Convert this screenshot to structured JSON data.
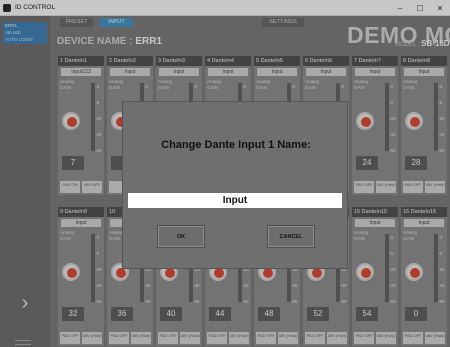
{
  "window": {
    "title": "ID CONTROL",
    "controls": [
      "–",
      "☐",
      "✕"
    ]
  },
  "sidebar": {
    "units": [
      {
        "label": "ERR1",
        "selected": true
      },
      {
        "label": "SB-16D",
        "selected": false
      },
      {
        "label": "AUTO LOGIN",
        "selected": false
      }
    ],
    "next_label": "›"
  },
  "tabs": [
    {
      "label": "PRESET"
    },
    {
      "label": "INPUT",
      "active": true
    },
    {
      "label": "SETTINGS"
    }
  ],
  "device": {
    "name_prefix": "DEVICE NAME :",
    "name_value": "ERR1",
    "demo_text": "DEMO MODE",
    "model_label": "MODEL :",
    "model_value": "SB-16D"
  },
  "channels": [
    {
      "header": "1  DanteIn1",
      "name": "Input123",
      "gain": "7",
      "pad": "PAD ON",
      "phantom": "48V OFF"
    },
    {
      "header": "2  DanteIn2",
      "name": "Input",
      "gain": "",
      "pad": "",
      "phantom": ""
    },
    {
      "header": "3  DanteIn3",
      "name": "Input",
      "gain": "",
      "pad": "",
      "phantom": ""
    },
    {
      "header": "4  DanteIn4",
      "name": "Input",
      "gain": "",
      "pad": "",
      "phantom": ""
    },
    {
      "header": "5  DanteIn5",
      "name": "Input",
      "gain": "",
      "pad": "",
      "phantom": ""
    },
    {
      "header": "6  DanteIn6",
      "name": "Input",
      "gain": "",
      "pad": "",
      "phantom": ""
    },
    {
      "header": "7  DanteIn7",
      "name": "Input",
      "gain": "24",
      "pad": "PAD OFF",
      "phantom": "48V (Hold)"
    },
    {
      "header": "8  DanteIn8",
      "name": "Input",
      "gain": "28",
      "pad": "PAD OFF",
      "phantom": "48V (Hold)"
    },
    {
      "header": "9  DanteIn9",
      "name": "Input",
      "gain": "32",
      "pad": "PAD OFF",
      "phantom": "48V (Hold)"
    },
    {
      "header": "10",
      "name": "",
      "gain": "36",
      "pad": "PAD OFF",
      "phantom": "48V (Hold)"
    },
    {
      "header": "",
      "name": "",
      "gain": "40",
      "pad": "PAD OFF",
      "phantom": "48V (Hold)"
    },
    {
      "header": "",
      "name": "",
      "gain": "44",
      "pad": "PAD OFF",
      "phantom": "48V (Hold)"
    },
    {
      "header": "",
      "name": "",
      "gain": "48",
      "pad": "PAD OFF",
      "phantom": "48V (Hold)"
    },
    {
      "header": "",
      "name": "",
      "gain": "52",
      "pad": "PAD OFF",
      "phantom": "48V (Hold)"
    },
    {
      "header": "15 DanteIn15",
      "name": "Input",
      "gain": "54",
      "pad": "PAD OFF",
      "phantom": "48V (Hold)"
    },
    {
      "header": "16 DanteIn16",
      "name": "Input",
      "gain": "0",
      "pad": "PAD OFF",
      "phantom": "48V (Hold)"
    }
  ],
  "strip_labels": {
    "analog": "Analog",
    "gain": "GAIN",
    "scale": [
      "-3",
      "-9",
      "-20",
      "-40",
      "-60"
    ]
  },
  "dialog": {
    "title": "Change Dante Input 1 Name:",
    "input_value": "Input",
    "ok_label": "OK",
    "cancel_label": "CANCEL"
  },
  "colors": {
    "accent": "#3e95c8",
    "knob": "#e0442f",
    "background": "#7a7a7a"
  }
}
